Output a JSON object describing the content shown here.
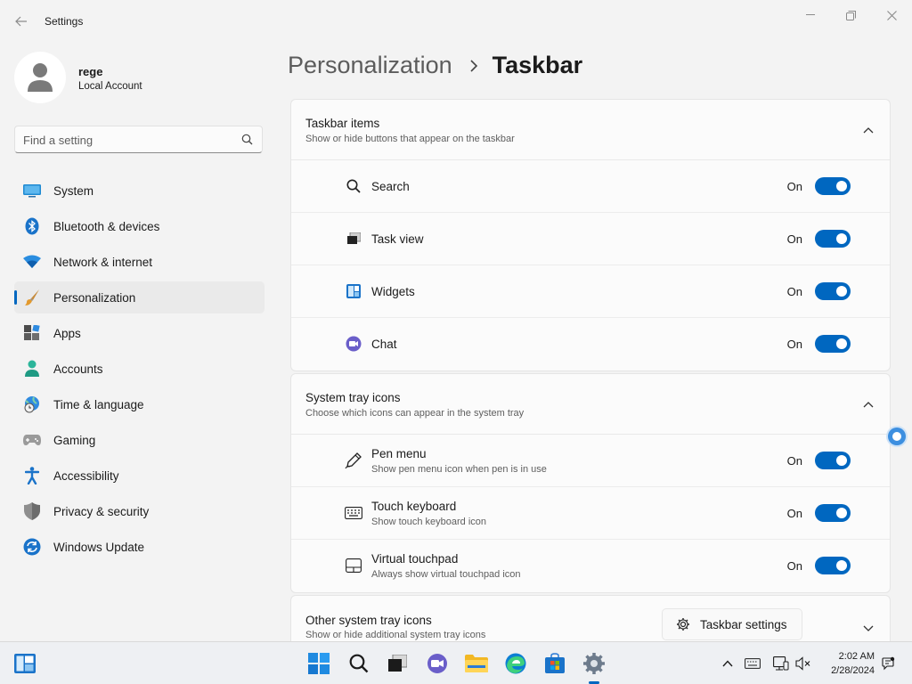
{
  "window": {
    "title": "Settings"
  },
  "user": {
    "name": "rege",
    "account_type": "Local Account"
  },
  "search": {
    "placeholder": "Find a setting"
  },
  "nav": [
    {
      "label": "System",
      "icon": "system-icon",
      "selected": false
    },
    {
      "label": "Bluetooth & devices",
      "icon": "bluetooth-icon",
      "selected": false
    },
    {
      "label": "Network & internet",
      "icon": "wifi-icon",
      "selected": false
    },
    {
      "label": "Personalization",
      "icon": "brush-icon",
      "selected": true
    },
    {
      "label": "Apps",
      "icon": "apps-icon",
      "selected": false
    },
    {
      "label": "Accounts",
      "icon": "accounts-icon",
      "selected": false
    },
    {
      "label": "Time & language",
      "icon": "globe-clock-icon",
      "selected": false
    },
    {
      "label": "Gaming",
      "icon": "gamepad-icon",
      "selected": false
    },
    {
      "label": "Accessibility",
      "icon": "accessibility-icon",
      "selected": false
    },
    {
      "label": "Privacy & security",
      "icon": "shield-icon",
      "selected": false
    },
    {
      "label": "Windows Update",
      "icon": "update-icon",
      "selected": false
    }
  ],
  "breadcrumb": {
    "parent": "Personalization",
    "current": "Taskbar"
  },
  "taskbar_items": {
    "title": "Taskbar items",
    "subtitle": "Show or hide buttons that appear on the taskbar",
    "rows": [
      {
        "label": "Search",
        "state": "On",
        "icon": "search-icon"
      },
      {
        "label": "Task view",
        "state": "On",
        "icon": "task-view-icon"
      },
      {
        "label": "Widgets",
        "state": "On",
        "icon": "widgets-icon"
      },
      {
        "label": "Chat",
        "state": "On",
        "icon": "chat-icon"
      }
    ]
  },
  "system_tray": {
    "title": "System tray icons",
    "subtitle": "Choose which icons can appear in the system tray",
    "rows": [
      {
        "label": "Pen menu",
        "desc": "Show pen menu icon when pen is in use",
        "state": "On",
        "icon": "pen-icon"
      },
      {
        "label": "Touch keyboard",
        "desc": "Show touch keyboard icon",
        "state": "On",
        "icon": "keyboard-icon"
      },
      {
        "label": "Virtual touchpad",
        "desc": "Always show virtual touchpad icon",
        "state": "On",
        "icon": "touchpad-icon"
      }
    ]
  },
  "other_tray": {
    "title": "Other system tray icons",
    "subtitle": "Show or hide additional system tray icons"
  },
  "floating_button": {
    "label": "Taskbar settings",
    "icon": "gear-icon"
  },
  "clock": {
    "time": "2:02 AM",
    "date": "2/28/2024"
  },
  "colors": {
    "accent": "#0067c0",
    "background": "#f3f3f3",
    "card": "#fbfbfb"
  }
}
